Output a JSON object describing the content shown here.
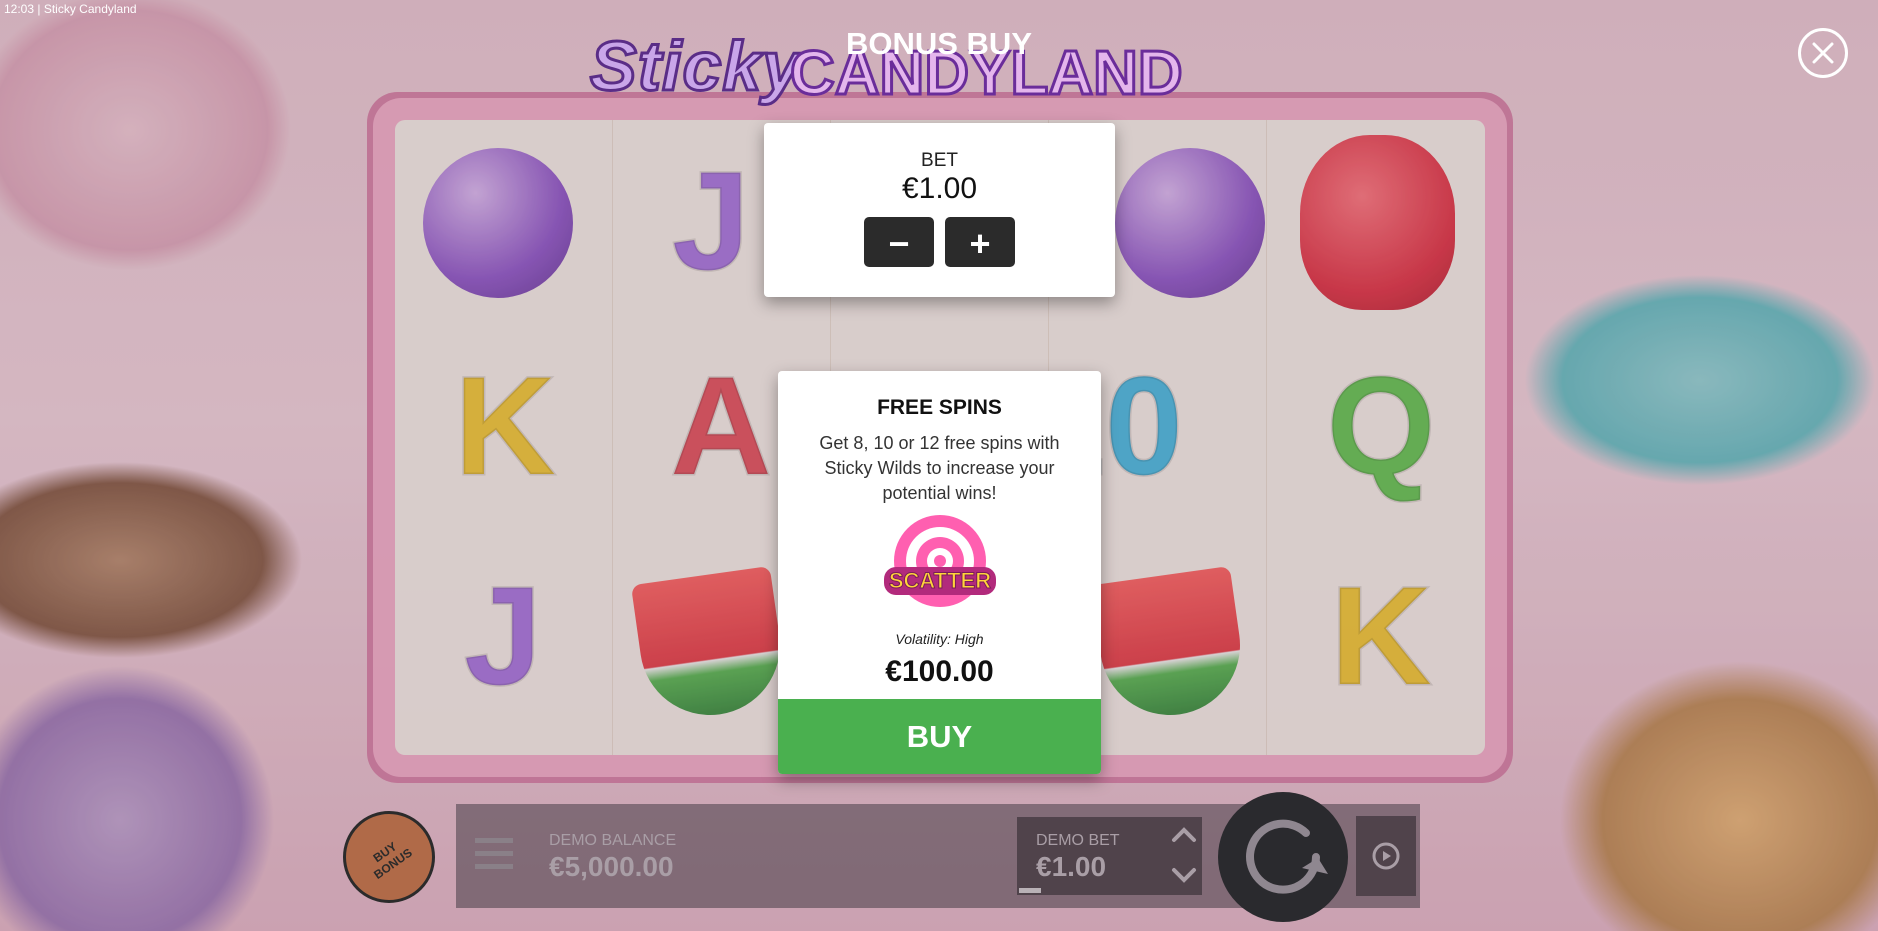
{
  "status_bar": {
    "time": "12:03",
    "separator": "|",
    "app_title": "Sticky Candyland"
  },
  "logo": {
    "word1": "Sticky",
    "word2": "CANDYLAND"
  },
  "screen_title": "BONUS BUY",
  "close_icon": "close-icon",
  "bet_panel": {
    "label": "BET",
    "value": "€1.00",
    "decrease_symbol": "−",
    "increase_symbol": "+"
  },
  "free_spins": {
    "title": "FREE SPINS",
    "description": "Get 8, 10 or 12 free spins with Sticky Wilds to increase your potential wins!",
    "scatter_text": "SCATTER",
    "volatility": "Volatility: High",
    "price": "€100.00",
    "buy_label": "BUY"
  },
  "reels": {
    "symbols": [
      [
        "lollipop",
        "K",
        "J"
      ],
      [
        "J",
        "A",
        "watermelon"
      ],
      [
        "",
        "",
        ""
      ],
      [
        "lollipop",
        "10",
        "watermelon"
      ],
      [
        "gummy-bear",
        "Q",
        "K"
      ]
    ],
    "letter_symbols": [
      "J",
      "K",
      "A",
      "10",
      "Q",
      "J",
      "K"
    ]
  },
  "bottom_bar": {
    "buy_bonus_label": "BUY BONUS",
    "demo_balance_label": "DEMO BALANCE",
    "demo_balance_value": "€5,000.00",
    "demo_bet_label": "DEMO BET",
    "demo_bet_value": "€1.00"
  },
  "colors": {
    "buy_green": "#4ab04f",
    "panel_white": "#ffffff",
    "dark_button": "#2b2b2b"
  }
}
